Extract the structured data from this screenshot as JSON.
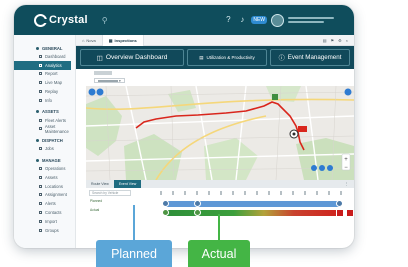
{
  "brand": {
    "name": "Crystal"
  },
  "colors": {
    "header": "#0f4d5c",
    "dashbar": "#11495a",
    "planned": "#5ba6d8",
    "actual": "#44b545",
    "route": "#d9261c"
  },
  "header": {
    "new_badge": "NEW"
  },
  "sidebar": {
    "sections": [
      {
        "title": "GENERAL",
        "items": [
          "Dashboard",
          "Analytics",
          "Report",
          "Live Map",
          "Replay",
          "Info"
        ]
      },
      {
        "title": "ASSETS",
        "items": [
          "Fleet Alerts",
          "Asset Maintenance"
        ]
      },
      {
        "title": "DISPATCH",
        "items": [
          "Jobs"
        ]
      },
      {
        "title": "MANAGE",
        "items": [
          "Operations",
          "Assets",
          "Locations",
          "Assignment",
          "Alerts",
          "Contacts",
          "Import",
          "Groups"
        ]
      }
    ],
    "active_item": "Analytics"
  },
  "tabs": {
    "items": [
      "Nova",
      "Inspections"
    ],
    "active": "Inspections"
  },
  "dashboard_buttons": {
    "overview": "Overview Dashboard",
    "utilization": "Utilization & Productivity",
    "events": "Event Management"
  },
  "timeline": {
    "tabs": [
      "Route View",
      "Event View"
    ],
    "active_tab": "Event View",
    "search_placeholder": "Search by Vehicle",
    "planned_label": "Planned",
    "actual_label": "Actual"
  },
  "callouts": {
    "planned": "Planned",
    "actual": "Actual"
  }
}
